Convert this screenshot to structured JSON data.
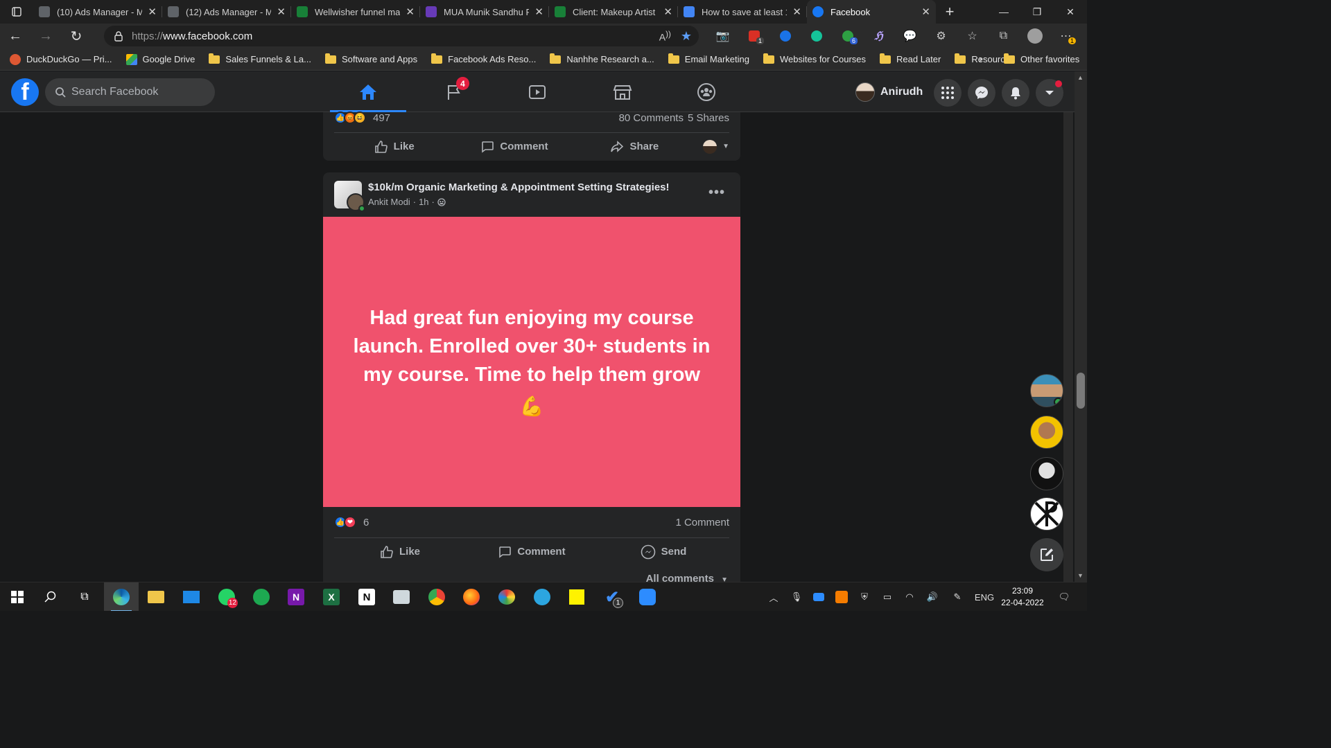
{
  "browser": {
    "tabs": [
      {
        "title": "(10) Ads Manager - M",
        "color": "#5f6368"
      },
      {
        "title": "(12) Ads Manager - M",
        "color": "#5f6368"
      },
      {
        "title": "Wellwisher funnel ma",
        "color": "#188038"
      },
      {
        "title": "MUA Munik Sandhu F",
        "color": "#673ab7"
      },
      {
        "title": "Client: Makeup Artist",
        "color": "#188038"
      },
      {
        "title": "How to save at least 1",
        "color": "#4285f4"
      },
      {
        "title": "Facebook",
        "color": "#1877f2"
      }
    ],
    "url_scheme": "https://",
    "url_host": "www.facebook.com",
    "favorites": [
      {
        "label": "DuckDuckGo — Pri...",
        "type": "site",
        "color": "#de5833"
      },
      {
        "label": "Google Drive",
        "type": "site",
        "color": "#34a853"
      },
      {
        "label": "Sales Funnels & La...",
        "type": "folder"
      },
      {
        "label": "Software and Apps",
        "type": "folder"
      },
      {
        "label": "Facebook Ads Reso...",
        "type": "folder"
      },
      {
        "label": "Nanhhe Research a...",
        "type": "folder"
      },
      {
        "label": "Email Marketing",
        "type": "folder"
      },
      {
        "label": "Websites for Courses",
        "type": "folder"
      },
      {
        "label": "Read Later",
        "type": "folder"
      },
      {
        "label": "Resources",
        "type": "folder"
      }
    ],
    "other_favorites": "Other favorites",
    "extension_badges": {
      "calendar": "1",
      "gmail": "6",
      "profile": "1"
    }
  },
  "facebook": {
    "search_placeholder": "Search Facebook",
    "nav_badge_pages": "4",
    "user_name": "Anirudh",
    "accent": "#2d88ff"
  },
  "post_prev": {
    "reaction_count": "497",
    "comments": "80 Comments",
    "shares": "5 Shares",
    "actions": {
      "like": "Like",
      "comment": "Comment",
      "share": "Share"
    }
  },
  "post": {
    "group_name": "$10k/m Organic Marketing & Appointment Setting Strategies!",
    "author": "Ankit Modi",
    "time": "1h",
    "body_text": "Had great fun enjoying my course launch. Enrolled over 30+ students in my course. Time to help them grow",
    "body_emoji": "💪",
    "body_bg": "#f0526d",
    "reaction_count": "6",
    "comments": "1 Comment",
    "actions": {
      "like": "Like",
      "comment": "Comment",
      "send": "Send"
    },
    "all_comments": "All comments"
  },
  "taskbar": {
    "whatsapp_badge": "12",
    "todo_badge": "1",
    "language": "ENG",
    "time": "23:09",
    "date": "22-04-2022"
  }
}
